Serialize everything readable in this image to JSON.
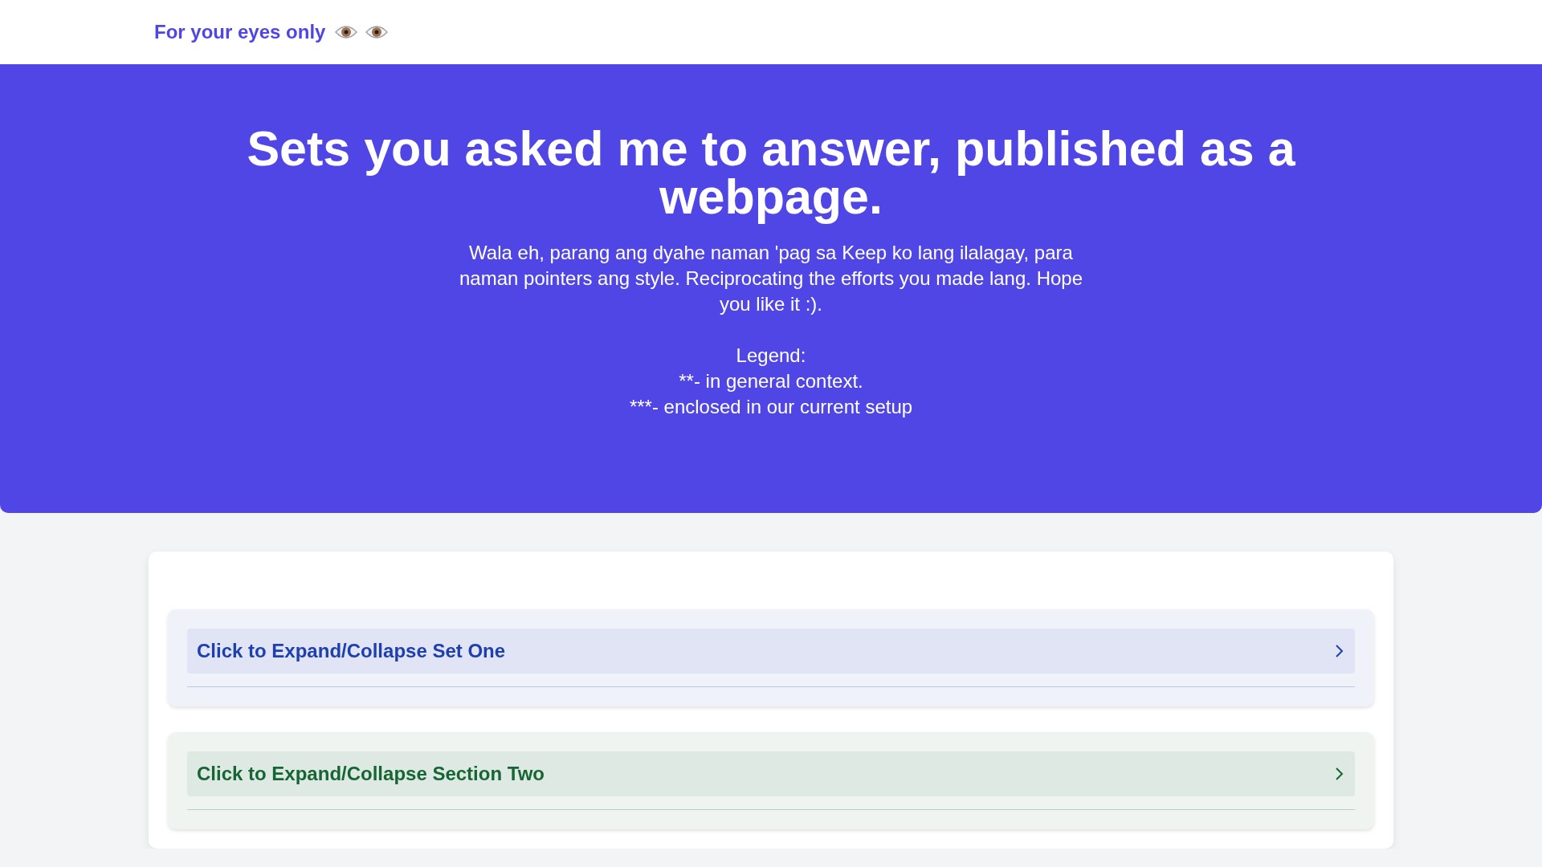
{
  "navbar": {
    "brand": "For your eyes only"
  },
  "hero": {
    "title": "Sets you asked me to answer, published as a webpage.",
    "intro": "Wala eh, parang ang dyahe naman 'pag sa Keep ko lang ilalagay, para naman pointers ang style. Reciprocating the efforts you made lang. Hope you like it :).",
    "legend_title": "Legend:",
    "legend": [
      "**- in general context.",
      "***- enclosed in our current setup"
    ]
  },
  "sections": [
    {
      "title": "Click to Expand/Collapse Set One",
      "color": "#1e40af",
      "expanded": false
    },
    {
      "title": "Click to Expand/Collapse Section Two",
      "color": "#166534",
      "expanded": false
    }
  ]
}
